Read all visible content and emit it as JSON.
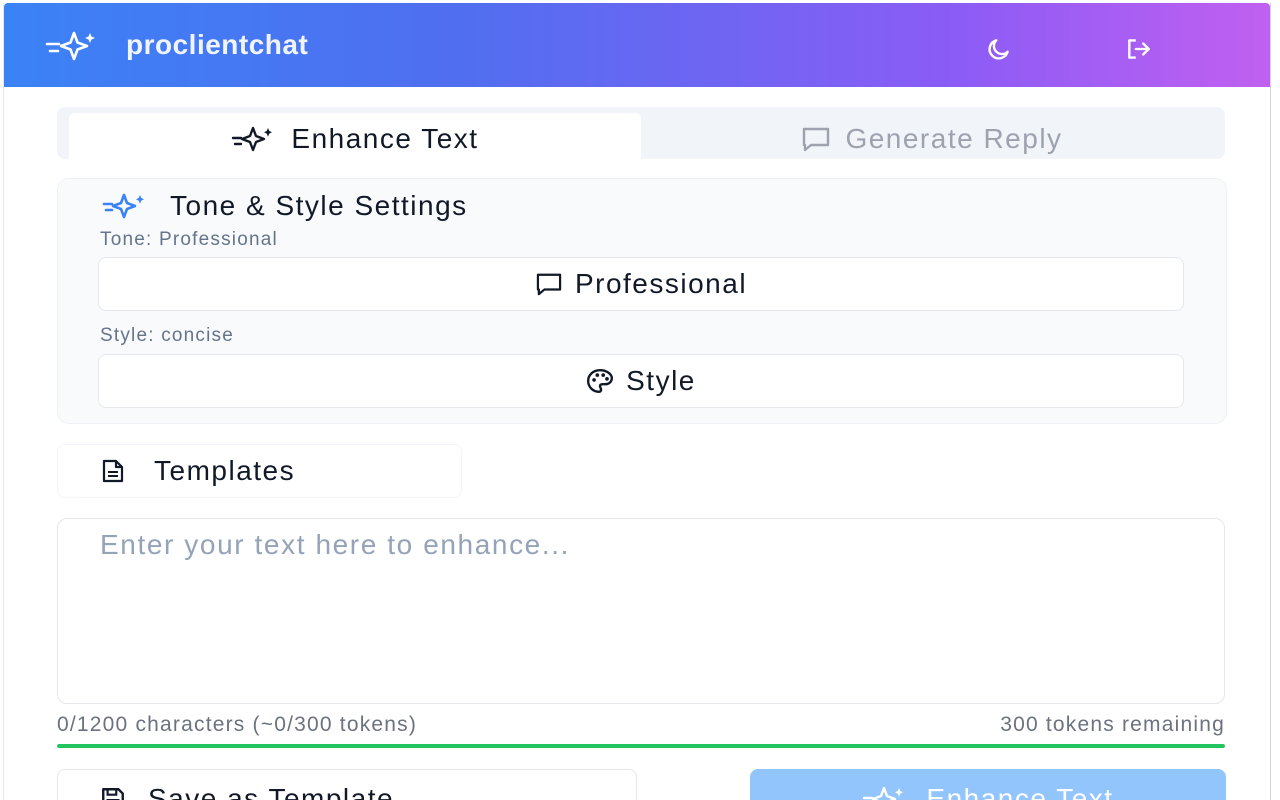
{
  "app": {
    "name": "proclientchat"
  },
  "tabs": [
    {
      "label": "Enhance Text",
      "active": true
    },
    {
      "label": "Generate Reply",
      "active": false
    }
  ],
  "settings": {
    "title": "Tone & Style Settings",
    "tone_label": "Tone: Professional",
    "tone_value": "Professional",
    "style_label": "Style: concise",
    "style_button": "Style"
  },
  "templates": {
    "label": "Templates"
  },
  "editor": {
    "placeholder": "Enter your text here to enhance...",
    "value": "",
    "counter": "0/1200 characters (~0/300 tokens)",
    "remaining": "300 tokens remaining",
    "progress": 1.0
  },
  "actions": {
    "save_template": "Save as Template",
    "enhance": "Enhance Text"
  },
  "colors": {
    "header_gradient_start": "#3b82f6",
    "header_gradient_end": "#c060f0",
    "accent": "#3b82f6",
    "progress": "#22c55e",
    "enhance_button": "#93c5fd"
  },
  "icons": {
    "brand": "sparkles-icon",
    "theme": "moon-icon",
    "logout": "logout-icon",
    "enhance_tab": "sparkles-icon",
    "reply_tab": "message-square-icon",
    "settings": "sparkles-icon",
    "tone": "message-square-icon",
    "style": "palette-icon",
    "templates": "file-text-icon",
    "save": "save-icon",
    "enhance": "sparkles-icon"
  }
}
